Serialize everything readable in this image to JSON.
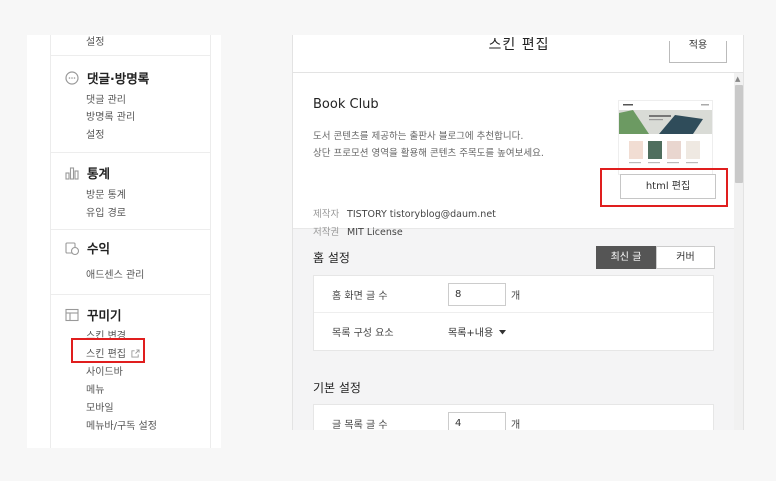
{
  "sidebar": {
    "top_item": "설정",
    "comments": {
      "title": "댓글·방명록",
      "items": [
        "댓글 관리",
        "방명록 관리",
        "설정"
      ]
    },
    "stats": {
      "title": "통계",
      "items": [
        "방문 통계",
        "유입 경로"
      ]
    },
    "revenue": {
      "title": "수익",
      "items": [
        "애드센스 관리"
      ]
    },
    "decor": {
      "title": "꾸미기",
      "items": [
        "스킨 변경",
        "스킨 편집",
        "사이드바",
        "메뉴",
        "모바일",
        "메뉴바/구독 설정"
      ]
    }
  },
  "header": {
    "title": "스킨 편집",
    "apply_label": "적용"
  },
  "skin": {
    "name": "Book Club",
    "desc_line1": "도서 콘텐츠를 제공하는 출판사 블로그에 추천합니다.",
    "desc_line2": "상단 프로모션 영역을 활용해 콘텐츠 주목도를 높여보세요.",
    "maker_label": "제작자",
    "maker_value": "TISTORY tistoryblog@daum.net",
    "license_label": "저작권",
    "license_value": "MIT License",
    "html_edit_label": "html 편집"
  },
  "home_settings": {
    "title": "홈 설정",
    "tabs": [
      {
        "label": "최신 글",
        "selected": true
      },
      {
        "label": "커버",
        "selected": false
      }
    ],
    "post_count_label": "홈 화면 글 수",
    "post_count_value": "8",
    "unit": "개",
    "list_elements_label": "목록 구성 요소",
    "list_elements_value": "목록+내용"
  },
  "basic_settings": {
    "title": "기본 설정",
    "list_count_label": "글 목록 글 수",
    "list_count_value": "4",
    "unit": "개"
  },
  "colors": {
    "highlight": "#e01e1e",
    "tab_active": "#555555"
  }
}
